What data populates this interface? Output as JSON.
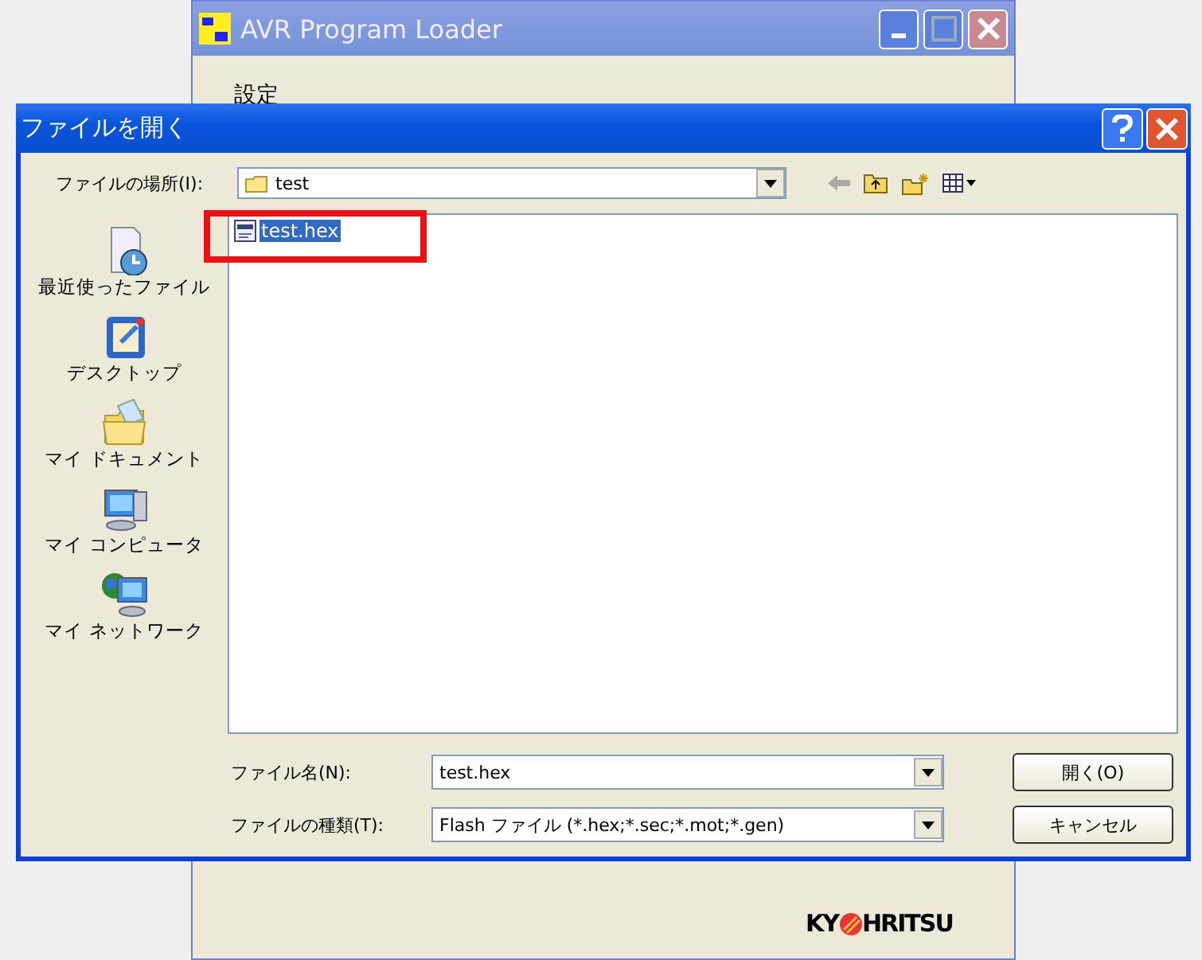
{
  "back_window": {
    "title": "AVR Program Loader",
    "section_label": "設定",
    "logo": [
      "KY",
      "HRITSU"
    ]
  },
  "dialog": {
    "title": "ファイルを開く",
    "location": {
      "label": "ファイルの場所(I):",
      "value": "test"
    },
    "places": [
      {
        "label": "最近使ったファイル",
        "kind": "recent"
      },
      {
        "label": "デスクトップ",
        "kind": "desktop"
      },
      {
        "label": "マイ ドキュメント",
        "kind": "documents"
      },
      {
        "label": "マイ コンピュータ",
        "kind": "computer"
      },
      {
        "label": "マイ ネットワーク",
        "kind": "network"
      }
    ],
    "files": [
      {
        "name": "test.hex",
        "selected": true,
        "highlighted": true
      }
    ],
    "filename": {
      "label": "ファイル名(N):",
      "value": "test.hex"
    },
    "filetype": {
      "label": "ファイルの種類(T):",
      "value": "Flash ファイル (*.hex;*.sec;*.mot;*.gen)"
    },
    "buttons": [
      "開く(O)",
      "キャンセル"
    ]
  }
}
